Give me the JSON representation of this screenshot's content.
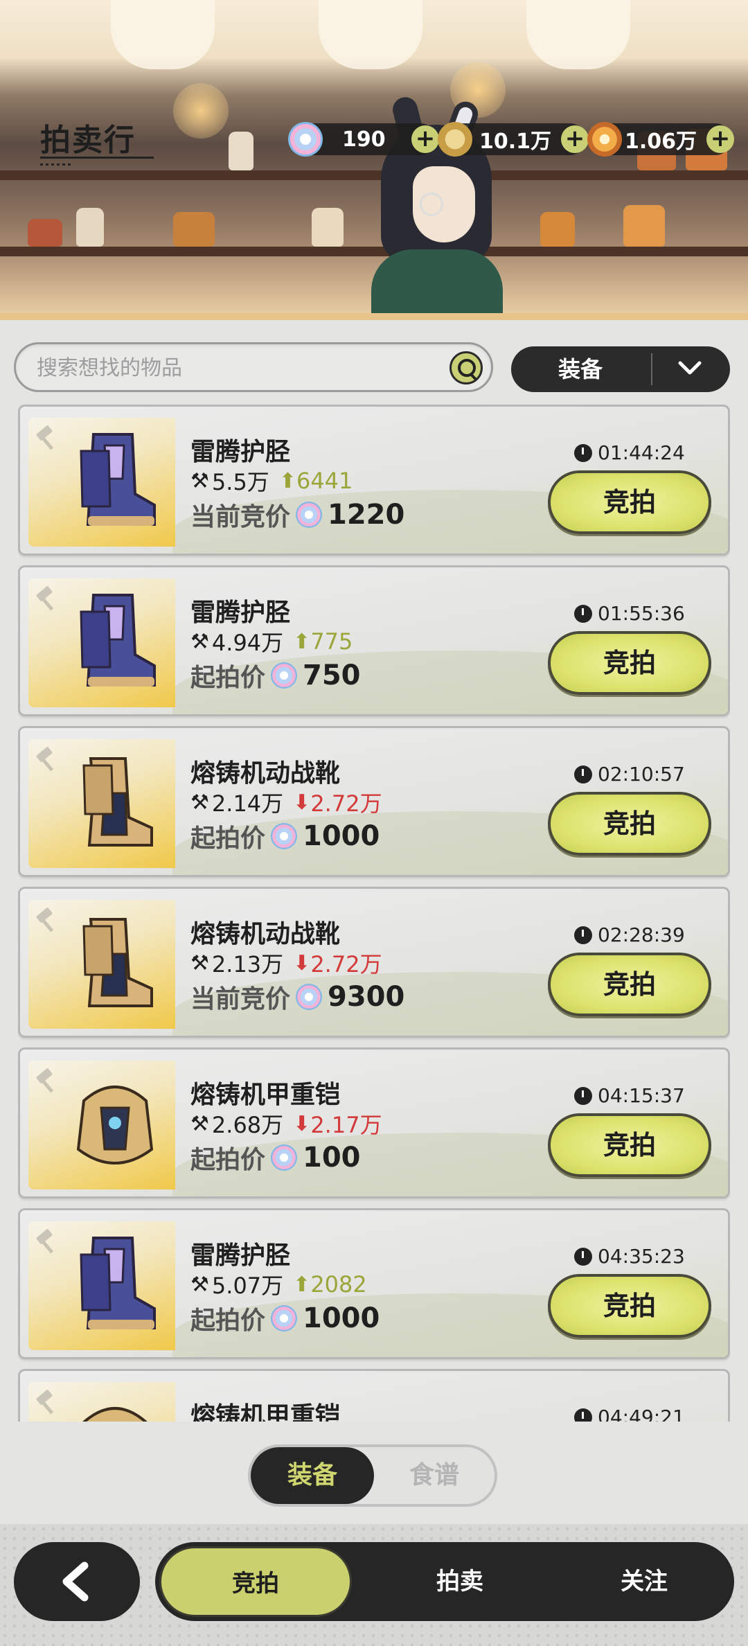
{
  "header": {
    "title": "拍卖行",
    "currencies": [
      {
        "icon": "gem-icon",
        "value": "190"
      },
      {
        "icon": "coin-icon",
        "value": "10.1万"
      },
      {
        "icon": "star-icon",
        "value": "1.06万"
      }
    ],
    "add_label": "+"
  },
  "search": {
    "placeholder": "搜索想找的物品",
    "value": ""
  },
  "filter": {
    "selected": "装备"
  },
  "auctions": [
    {
      "name": "雷腾护胫",
      "ref_price": "5.5万",
      "trend": "up",
      "trend_value": "6441",
      "price_label": "当前竞价",
      "price": "1220",
      "timer": "01:44:24",
      "button": "竞拍",
      "item": "boots-purple"
    },
    {
      "name": "雷腾护胫",
      "ref_price": "4.94万",
      "trend": "up",
      "trend_value": "775",
      "price_label": "起拍价",
      "price": "750",
      "timer": "01:55:36",
      "button": "竞拍",
      "item": "boots-purple"
    },
    {
      "name": "熔铸机动战靴",
      "ref_price": "2.14万",
      "trend": "down",
      "trend_value": "2.72万",
      "price_label": "起拍价",
      "price": "1000",
      "timer": "02:10:57",
      "button": "竞拍",
      "item": "boots-gold"
    },
    {
      "name": "熔铸机动战靴",
      "ref_price": "2.13万",
      "trend": "down",
      "trend_value": "2.72万",
      "price_label": "当前竞价",
      "price": "9300",
      "timer": "02:28:39",
      "button": "竞拍",
      "item": "boots-gold"
    },
    {
      "name": "熔铸机甲重铠",
      "ref_price": "2.68万",
      "trend": "down",
      "trend_value": "2.17万",
      "price_label": "起拍价",
      "price": "100",
      "timer": "04:15:37",
      "button": "竞拍",
      "item": "armor-gold"
    },
    {
      "name": "雷腾护胫",
      "ref_price": "5.07万",
      "trend": "up",
      "trend_value": "2082",
      "price_label": "起拍价",
      "price": "1000",
      "timer": "04:35:23",
      "button": "竞拍",
      "item": "boots-purple"
    },
    {
      "name": "熔铸机甲重铠",
      "ref_price": "",
      "trend": "",
      "trend_value": "",
      "price_label": "",
      "price": "",
      "timer": "04:49:21",
      "button": "",
      "item": "armor-gold"
    }
  ],
  "category_tabs": [
    {
      "label": "装备",
      "active": true
    },
    {
      "label": "食谱",
      "active": false
    }
  ],
  "bottom_nav": {
    "back_icon": "back-arrow-icon",
    "items": [
      {
        "label": "竞拍",
        "active": true
      },
      {
        "label": "拍卖",
        "active": false
      },
      {
        "label": "关注",
        "active": false
      }
    ]
  },
  "colors": {
    "accent": "#cbd06e",
    "dark": "#262626",
    "up": "#9aa63a",
    "down": "#d33a3a"
  }
}
